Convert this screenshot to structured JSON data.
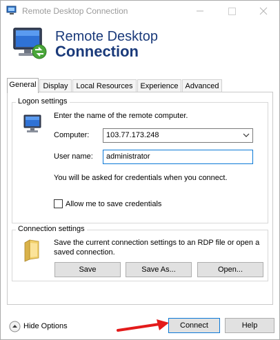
{
  "window": {
    "title": "Remote Desktop Connection",
    "controls": [
      "minimize",
      "maximize",
      "close"
    ]
  },
  "banner": {
    "line1": "Remote Desktop",
    "line2": "Connection"
  },
  "tabs": [
    {
      "label": "General",
      "active": true
    },
    {
      "label": "Display",
      "active": false
    },
    {
      "label": "Local Resources",
      "active": false
    },
    {
      "label": "Experience",
      "active": false
    },
    {
      "label": "Advanced",
      "active": false
    }
  ],
  "logon": {
    "legend": "Logon settings",
    "instruction": "Enter the name of the remote computer.",
    "computer_label": "Computer:",
    "computer_value": "103.77.173.248",
    "username_label": "User name:",
    "username_value": "administrator",
    "credentials_note": "You will be asked for credentials when you connect.",
    "save_credentials_label": "Allow me to save credentials",
    "save_credentials_checked": false
  },
  "connection": {
    "legend": "Connection settings",
    "description_line1": "Save the current connection settings to an RDP file or open a",
    "description_line2": "saved connection.",
    "save_button": "Save",
    "save_as_button": "Save As...",
    "open_button": "Open..."
  },
  "footer": {
    "hide_options": "Hide Options",
    "connect_button": "Connect",
    "help_button": "Help"
  },
  "colors": {
    "banner_text": "#1a3a7a",
    "annotation_arrow": "#e31b1b",
    "focus_border": "#0a78d7"
  }
}
